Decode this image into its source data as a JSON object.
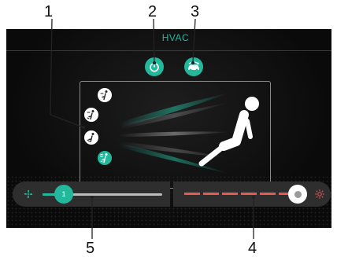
{
  "callouts": [
    "1",
    "2",
    "3",
    "4",
    "5"
  ],
  "header": {
    "title": "HVAC"
  },
  "fan": {
    "level": "1",
    "level_fraction": 0.1
  },
  "temperature": {
    "level_fraction": 0.85
  },
  "colors": {
    "accent": "#23b89b",
    "heat_red": "#e85a55",
    "panel_bg": "#0f0f0f",
    "bar_bg": "#2e2e2e"
  },
  "icons": {
    "power": "power-icon",
    "recirculation": "car-recirculation-icon",
    "fan": "fan-icon",
    "heat": "sun-heat-icon",
    "modes": [
      "seat-face-airflow-icon",
      "seat-face-feet-airflow-icon",
      "seat-feet-airflow-icon",
      "seat-defrost-airflow-icon"
    ]
  }
}
